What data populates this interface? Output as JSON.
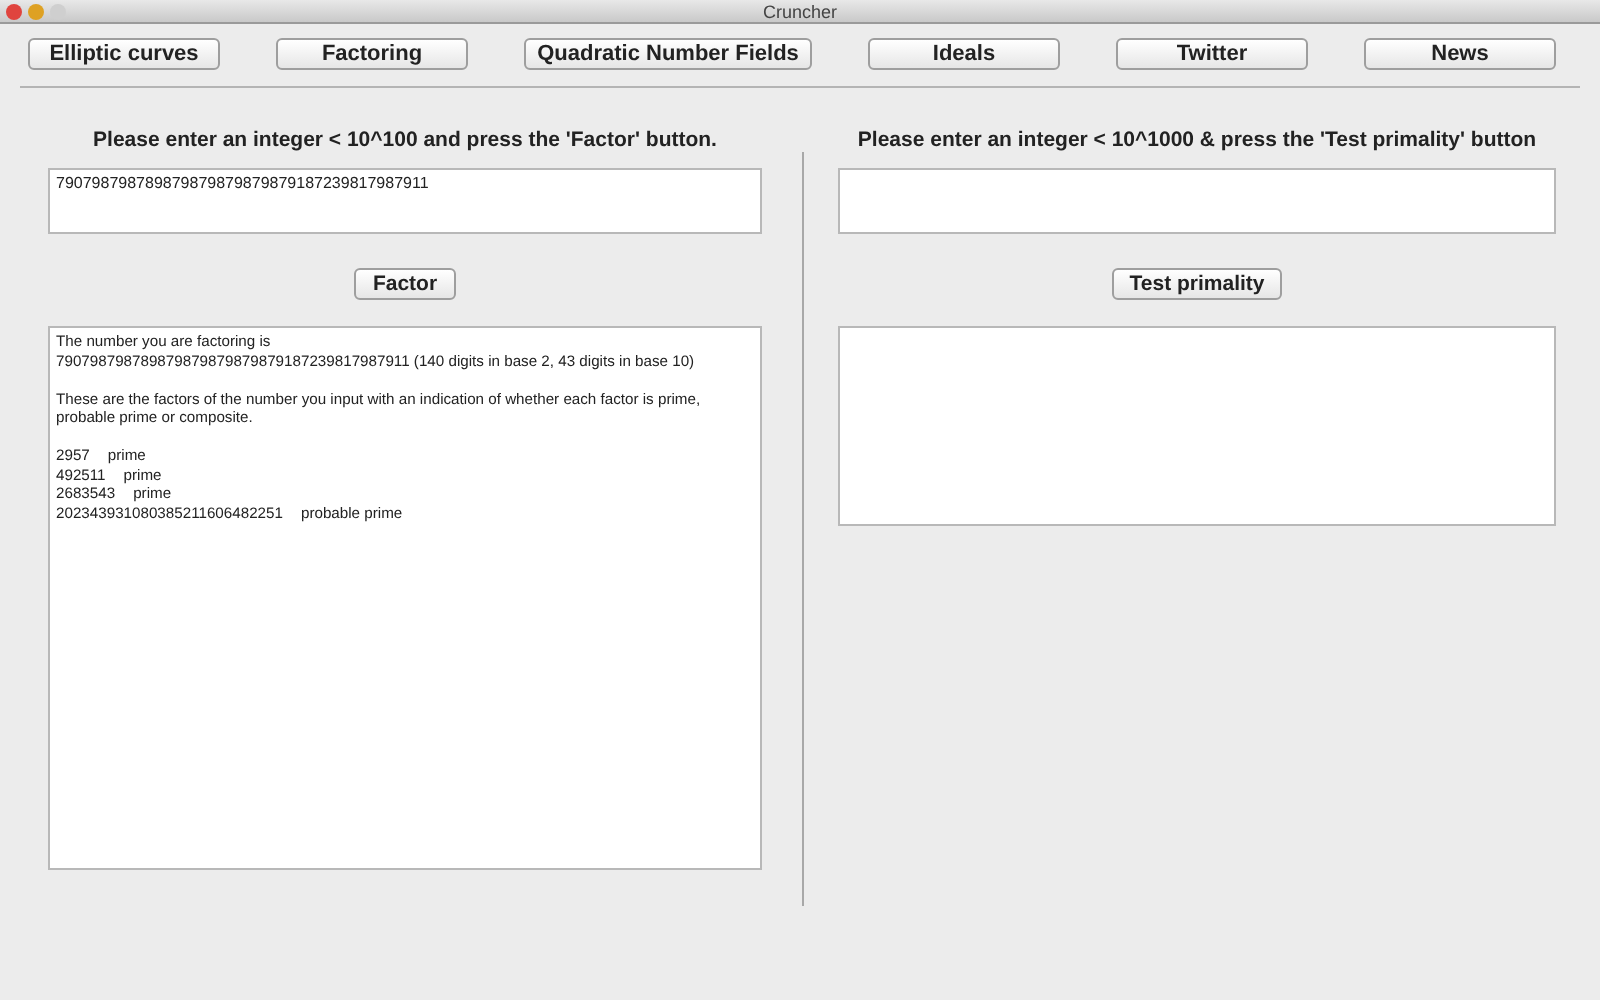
{
  "window": {
    "title": "Cruncher"
  },
  "nav_buttons": [
    "Elliptic curves",
    "Factoring",
    "Quadratic Number Fields",
    "Ideals",
    "Twitter",
    "News"
  ],
  "factor_panel": {
    "prompt": "Please enter an integer < 10^100 and press the 'Factor' button.",
    "input": {
      "value": "790798798789879879879879879187239817987911"
    },
    "button": "Factor",
    "output": {
      "paragraphs": [
        "The number you are factoring is\n790798798789879879879879879187239817987911 (140 digits in base 2, 43 digits in base 10)",
        "These are the factors of the number you input with an indication of whether each factor is prime, probable prime or composite."
      ],
      "factors": [
        {
          "number": "2957",
          "status": "prime"
        },
        {
          "number": "492511",
          "status": "prime"
        },
        {
          "number": "2683543",
          "status": "prime"
        },
        {
          "number": "202343931080385211606482251",
          "status": "probable prime"
        }
      ]
    }
  },
  "primality_panel": {
    "prompt": "Please enter an integer < 10^1000 & press the 'Test primality' button",
    "button": "Test primality"
  }
}
